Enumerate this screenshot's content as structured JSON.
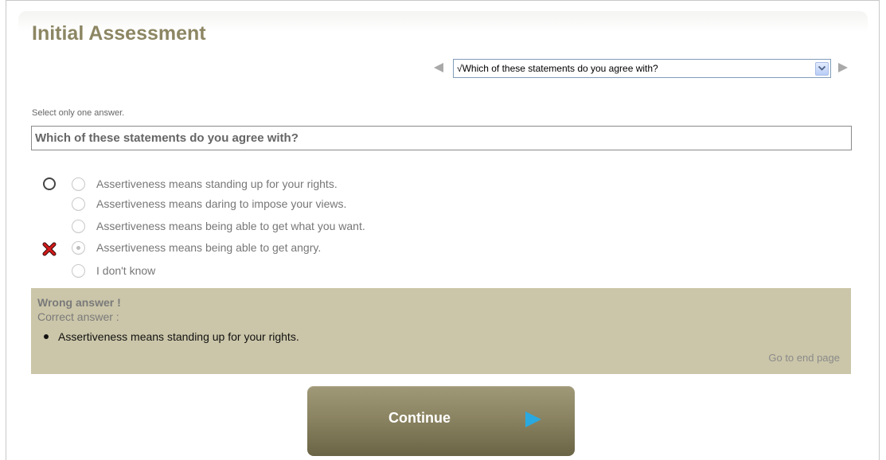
{
  "page": {
    "title": "Initial Assessment"
  },
  "navigation": {
    "selected_question": "√Which of these statements do you agree with?"
  },
  "question": {
    "instruction": "Select only one answer.",
    "text": "Which of these statements do you agree with?"
  },
  "options": [
    {
      "label": "Assertiveness means standing up for your rights.",
      "selected": false,
      "correct": true
    },
    {
      "label": "Assertiveness means daring to impose your views.",
      "selected": false,
      "correct": false
    },
    {
      "label": "Assertiveness means being able to get what you want.",
      "selected": false,
      "correct": false
    },
    {
      "label": "Assertiveness means being able to get angry.",
      "selected": true,
      "correct": false
    },
    {
      "label": "I don't know",
      "selected": false,
      "correct": false
    }
  ],
  "feedback": {
    "title": "Wrong answer !",
    "correct_label": "Correct answer :",
    "correct_answer": "Assertiveness means standing up for your rights.",
    "end_link": "Go to end page"
  },
  "continue_button": {
    "label": "Continue"
  },
  "colors": {
    "title": "#8c8663",
    "feedback_bg": "#cbc6a9",
    "button": "#8b8462",
    "arrow": "#2aa9e0",
    "wrong_mark": "#cc1111"
  }
}
